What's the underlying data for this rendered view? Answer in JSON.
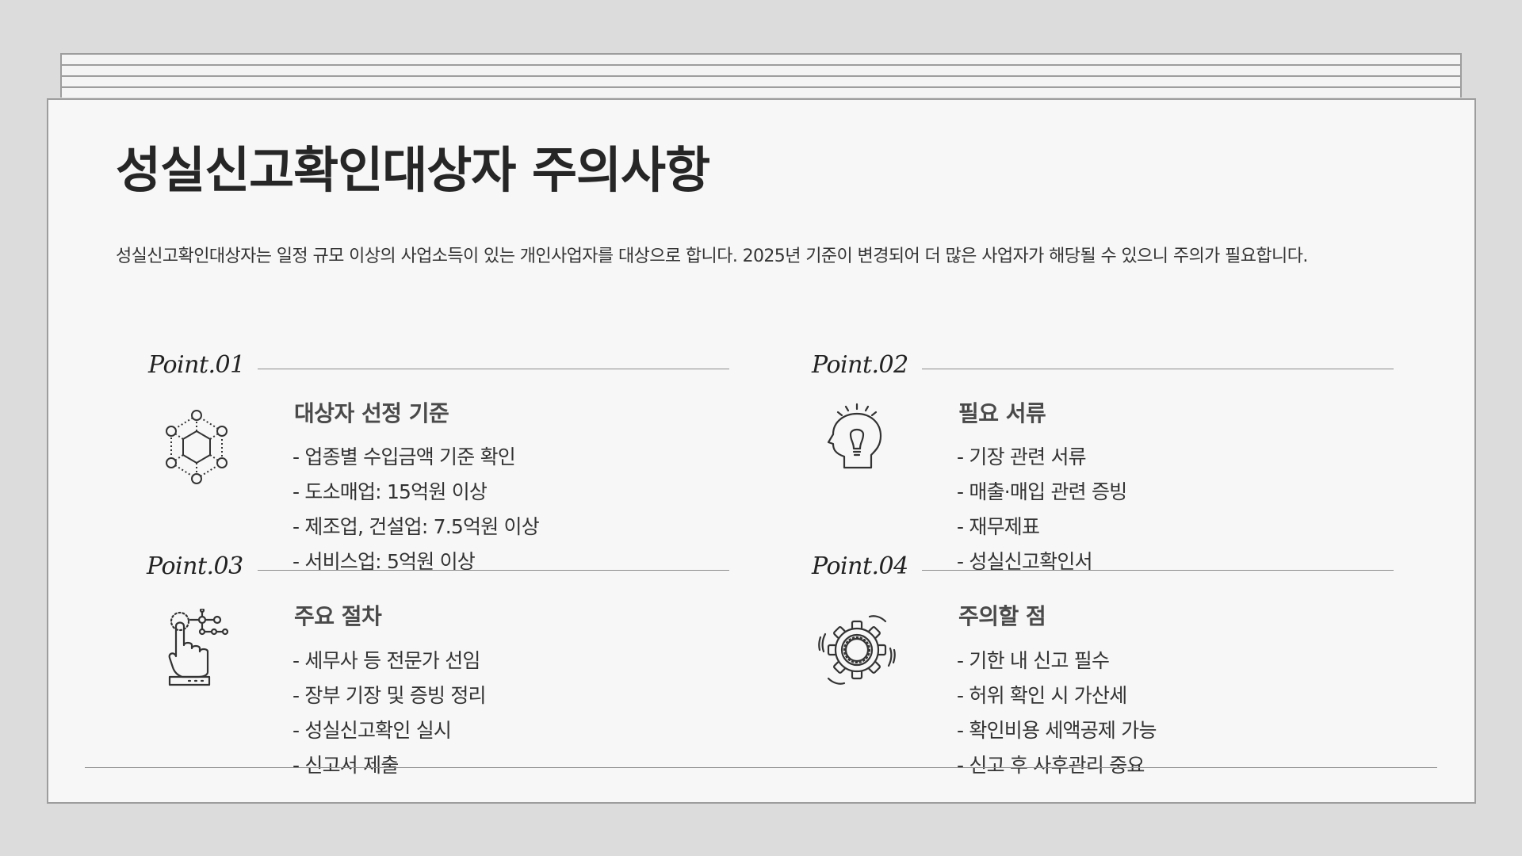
{
  "title": "성실신고확인대상자 주의사항",
  "description": "성실신고확인대상자는 일정 규모 이상의 사업소득이 있는 개인사업자를 대상으로 합니다. 2025년 기준이 변경되어 더 많은 사업자가 해당될 수 있으니 주의가 필요합니다.",
  "points": [
    {
      "label": "Point.01",
      "icon": "hexagon-network-icon",
      "heading": "대상자 선정 기준",
      "items": [
        "- 업종별 수입금액 기준 확인",
        "- 도소매업: 15억원 이상",
        "- 제조업, 건설업: 7.5억원 이상",
        "- 서비스업: 5억원 이상"
      ]
    },
    {
      "label": "Point.02",
      "icon": "head-lightbulb-icon",
      "heading": "필요 서류",
      "items": [
        "- 기장 관련 서류",
        "- 매출·매입 관련 증빙",
        "- 재무제표",
        "- 성실신고확인서"
      ]
    },
    {
      "label": "Point.03",
      "icon": "hand-tap-icon",
      "heading": "주요 절차",
      "items": [
        "- 세무사 등 전문가 선임",
        "- 장부 기장 및 증빙 정리",
        "- 성실신고확인 실시",
        "- 신고서 제출"
      ]
    },
    {
      "label": "Point.04",
      "icon": "gear-icon",
      "heading": "주의할 점",
      "items": [
        "- 기한 내 신고 필수",
        "- 허위 확인 시 가산세",
        "- 확인비용 세액공제 가능",
        "- 신고 후 사후관리 중요"
      ]
    }
  ]
}
